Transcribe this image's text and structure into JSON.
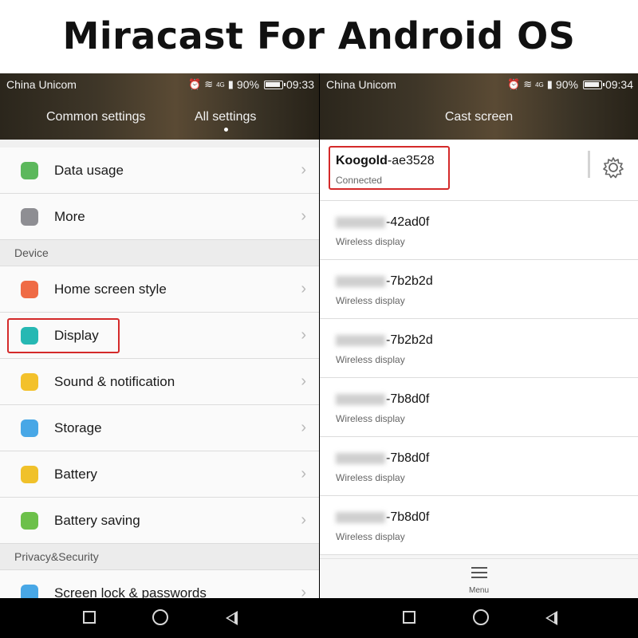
{
  "headline": "Miracast For Android OS",
  "left_phone": {
    "status": {
      "carrier": "China Unicom",
      "battery": "90%",
      "time": "09:33",
      "network": "4G"
    },
    "tabs": [
      {
        "label": "Common settings"
      },
      {
        "label": "All settings",
        "active": true
      }
    ],
    "items": [
      {
        "label": "Data usage",
        "icon": "data-usage-icon",
        "color": "#5cb85c"
      },
      {
        "label": "More",
        "icon": "more-icon",
        "color": "#8e8e93"
      },
      {
        "section": "Device"
      },
      {
        "label": "Home screen style",
        "icon": "home-icon",
        "color": "#ef6b45"
      },
      {
        "label": "Display",
        "icon": "display-icon",
        "color": "#26b8b3",
        "highlighted": true
      },
      {
        "label": "Sound & notification",
        "icon": "sound-icon",
        "color": "#f3c12b"
      },
      {
        "label": "Storage",
        "icon": "storage-icon",
        "color": "#48a7e6"
      },
      {
        "label": "Battery",
        "icon": "battery-icon",
        "color": "#f0c12a"
      },
      {
        "label": "Battery saving",
        "icon": "battery-saving-icon",
        "color": "#6cc04a"
      },
      {
        "section": "Privacy&Security"
      },
      {
        "label": "Screen lock & passwords",
        "icon": "lock-icon",
        "color": "#48a7e6"
      }
    ]
  },
  "right_phone": {
    "status": {
      "carrier": "China Unicom",
      "battery": "90%",
      "time": "09:34",
      "network": "4G"
    },
    "title": "Cast screen",
    "devices": [
      {
        "name_bold": "Koogold",
        "name_rest": "-ae3528",
        "status": "Connected",
        "highlighted": true,
        "blurred": false
      },
      {
        "name_rest": "-42ad0f",
        "status": "Wireless display",
        "blurred": true
      },
      {
        "name_rest": "-7b2b2d",
        "status": "Wireless display",
        "blurred": true
      },
      {
        "name_rest": "-7b2b2d",
        "status": "Wireless display",
        "blurred": true
      },
      {
        "name_rest": "-7b8d0f",
        "status": "Wireless display",
        "blurred": true
      },
      {
        "name_rest": "-7b8d0f",
        "status": "Wireless display",
        "blurred": true
      },
      {
        "name_rest": "-7b8d0f",
        "status": "Wireless display",
        "blurred": true
      }
    ],
    "menu_label": "Menu"
  },
  "colors": {
    "highlight": "#d42a2a",
    "topbar": "#3e3628"
  }
}
